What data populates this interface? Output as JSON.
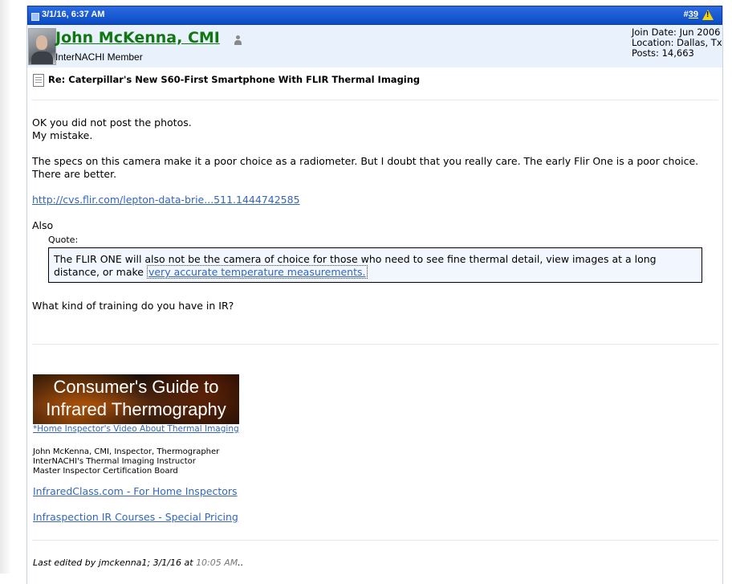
{
  "post": {
    "date": "3/1/16, 6:37 AM",
    "number_prefix": "#",
    "number": "39"
  },
  "user": {
    "name": "John McKenna, CMI",
    "title": "InterNACHI Member",
    "join_date": "Join Date: Jun 2006",
    "location": "Location: Dallas, Tx",
    "posts": "Posts: 14,663"
  },
  "post_title": "Re: Caterpillar's New S60-First Smartphone With FLIR Thermal Imaging",
  "message": {
    "line1": "OK you did not post the photos.",
    "line2": "My mistake.",
    "para2": "The specs on this camera make it a poor choice as a radiometer. But I doubt that you really care. The early Flir One is a poor choice. There are better.",
    "link": "http://cvs.flir.com/lepton-data-brie...511.1444742585",
    "also": "Also",
    "quote_label": "Quote:",
    "quote_text": "The FLIR ONE will also not be the camera of choice for those who need to see fine thermal detail, view images at a long distance, or make ",
    "quote_link": "very accurate temperature measurements.",
    "question": "What kind of training do you have in IR?"
  },
  "signature": {
    "banner_line1": "Consumer's Guide to",
    "banner_line2": "Infrared Thermography",
    "video_link": "*Home Inspector's Video About Thermal Imaging",
    "sig1": "John McKenna, CMI, Inspector, Thermographer",
    "sig2": "InterNACHI's Thermal Imaging Instructor",
    "sig3": "Master Inspector Certification Board",
    "link1": "InfraredClass.com - For Home Inspectors",
    "link2": "Infraspection IR Courses - Special Pricing"
  },
  "edited": {
    "prefix": "Last edited by jmckenna1; 3/1/16 at ",
    "time": "10:05 AM",
    "suffix": ".."
  },
  "colors": {
    "header_blue": "#0a4cc5",
    "username_green": "#117711",
    "link_blue": "#3366bb",
    "user_bar": "#e9f1fd"
  },
  "icons": [
    "post-status-icon",
    "warning-icon",
    "online-status-icon",
    "document-icon"
  ]
}
